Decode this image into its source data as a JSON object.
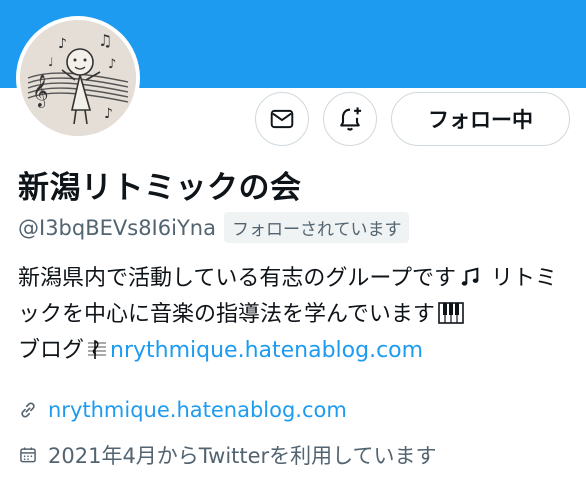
{
  "profile": {
    "name": "新潟リトミックの会",
    "handle": "@I3bqBEVs8I6iYna",
    "follows_you": "フォローされています",
    "bio_line1": "新潟県内で活動している有志のグループです",
    "bio_line2": "リトミックを中心に音楽の指導法を学んでいます",
    "bio_line3_prefix": "ブログ",
    "bio_link": "nrythmique.hatenablog.com",
    "url": "nrythmique.hatenablog.com",
    "joined": "2021年4月からTwitterを利用しています"
  },
  "actions": {
    "follow_label": "フォロー中",
    "message_icon": "envelope-icon",
    "notify_icon": "bell-plus-icon"
  },
  "colors": {
    "banner": "#1d9bf0",
    "link": "#1d9bf0",
    "secondary_text": "#536471"
  }
}
